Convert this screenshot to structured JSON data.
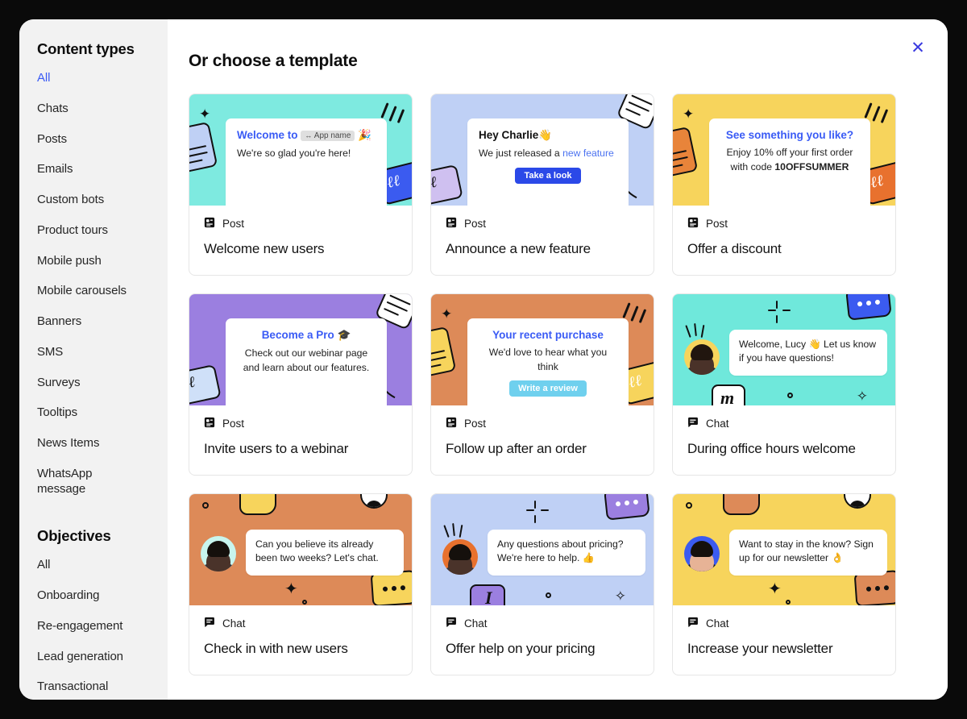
{
  "modal": {
    "close_label": "✕",
    "close_icon": "close-icon"
  },
  "sidebar": {
    "sections": [
      {
        "heading": "Content types",
        "items": [
          {
            "label": "All",
            "active": true
          },
          {
            "label": "Chats",
            "active": false
          },
          {
            "label": "Posts",
            "active": false
          },
          {
            "label": "Emails",
            "active": false
          },
          {
            "label": "Custom bots",
            "active": false
          },
          {
            "label": "Product tours",
            "active": false
          },
          {
            "label": "Mobile push",
            "active": false
          },
          {
            "label": "Mobile carousels",
            "active": false
          },
          {
            "label": "Banners",
            "active": false
          },
          {
            "label": "SMS",
            "active": false
          },
          {
            "label": "Surveys",
            "active": false
          },
          {
            "label": "Tooltips",
            "active": false
          },
          {
            "label": "News Items",
            "active": false
          },
          {
            "label": "WhatsApp message",
            "active": false
          }
        ]
      },
      {
        "heading": "Objectives",
        "items": [
          {
            "label": "All",
            "active": false
          },
          {
            "label": "Onboarding",
            "active": false
          },
          {
            "label": "Re-engagement",
            "active": false
          },
          {
            "label": "Lead generation",
            "active": false
          },
          {
            "label": "Transactional",
            "active": false
          }
        ]
      }
    ]
  },
  "main": {
    "title": "Or choose a template",
    "cards": [
      {
        "id": "welcome-new-users",
        "kind": "Post",
        "kind_icon": "post-icon",
        "title": "Welcome new users",
        "art_bg": "#7EEAE0",
        "preview": {
          "style": "post",
          "heading": "Welcome to",
          "heading_pill": "App name",
          "heading_emoji": "🎉",
          "body": "We're so glad you're here!"
        }
      },
      {
        "id": "announce-a-new-feature",
        "kind": "Post",
        "kind_icon": "post-icon",
        "title": "Announce a new feature",
        "art_bg": "#BFD0F5",
        "preview": {
          "style": "post",
          "heading": "Hey Charlie",
          "heading_emoji": "👋",
          "heading_dark": true,
          "body": "We just released a ",
          "body_link": "new feature",
          "button": "Take a look",
          "button_color": "#2b49e8"
        }
      },
      {
        "id": "offer-a-discount",
        "kind": "Post",
        "kind_icon": "post-icon",
        "title": "Offer a discount",
        "art_bg": "#F7D45C",
        "preview": {
          "style": "post-center",
          "heading": "See something you like?",
          "body": "Enjoy 10% off your first order",
          "body2": "with code ",
          "body2_bold": "10OFFSUMMER"
        }
      },
      {
        "id": "invite-users-to-a-webinar",
        "kind": "Post",
        "kind_icon": "post-icon",
        "title": "Invite users to a webinar",
        "art_bg": "#9B7FE0",
        "preview": {
          "style": "post-center",
          "heading": "Become a Pro",
          "heading_emoji": "🎓",
          "body": "Check out our webinar page",
          "body2": "and learn about our features."
        }
      },
      {
        "id": "follow-up-after-an-order",
        "kind": "Post",
        "kind_icon": "post-icon",
        "title": "Follow up after an order",
        "art_bg": "#DD8A58",
        "preview": {
          "style": "post-center",
          "heading": "Your recent purchase",
          "body": "We'd love to hear what you think",
          "button": "Write a review",
          "button_color": "#6fd0ee"
        }
      },
      {
        "id": "during-office-hours-welcome",
        "kind": "Chat",
        "kind_icon": "chat-icon",
        "title": "During office hours welcome",
        "art_bg": "#6FE8DB",
        "preview": {
          "style": "chat",
          "message": "Welcome, Lucy 👋 Let us know if you have questions!",
          "avatar_bg": "#F7D45C",
          "blob_color": "#3b5bf0"
        }
      },
      {
        "id": "check-in-with-new-users",
        "kind": "Chat",
        "kind_icon": "chat-icon",
        "title": "Check in with new users",
        "art_bg": "#DD8A58",
        "preview": {
          "style": "chat",
          "message": "Can you believe its already been two weeks? Let's chat.",
          "avatar_bg": "#C8F5EE",
          "blob_color": "#F7D45C"
        }
      },
      {
        "id": "offer-help-on-your-pricing",
        "kind": "Chat",
        "kind_icon": "chat-icon",
        "title": "Offer help on your pricing",
        "art_bg": "#BFD0F5",
        "preview": {
          "style": "chat",
          "message": "Any questions about pricing? We're here to help. 👍",
          "avatar_bg": "#E8712E",
          "blob_color": "#9B7FE0"
        }
      },
      {
        "id": "increase-your-newsletter",
        "kind": "Chat",
        "kind_icon": "chat-icon",
        "title": "Increase your newsletter",
        "art_bg": "#F7D45C",
        "preview": {
          "style": "chat",
          "message": "Want to stay in the know? Sign up for our newsletter 👌",
          "avatar_bg": "#3b5bf0",
          "blob_color": "#DD8A58"
        }
      }
    ]
  }
}
